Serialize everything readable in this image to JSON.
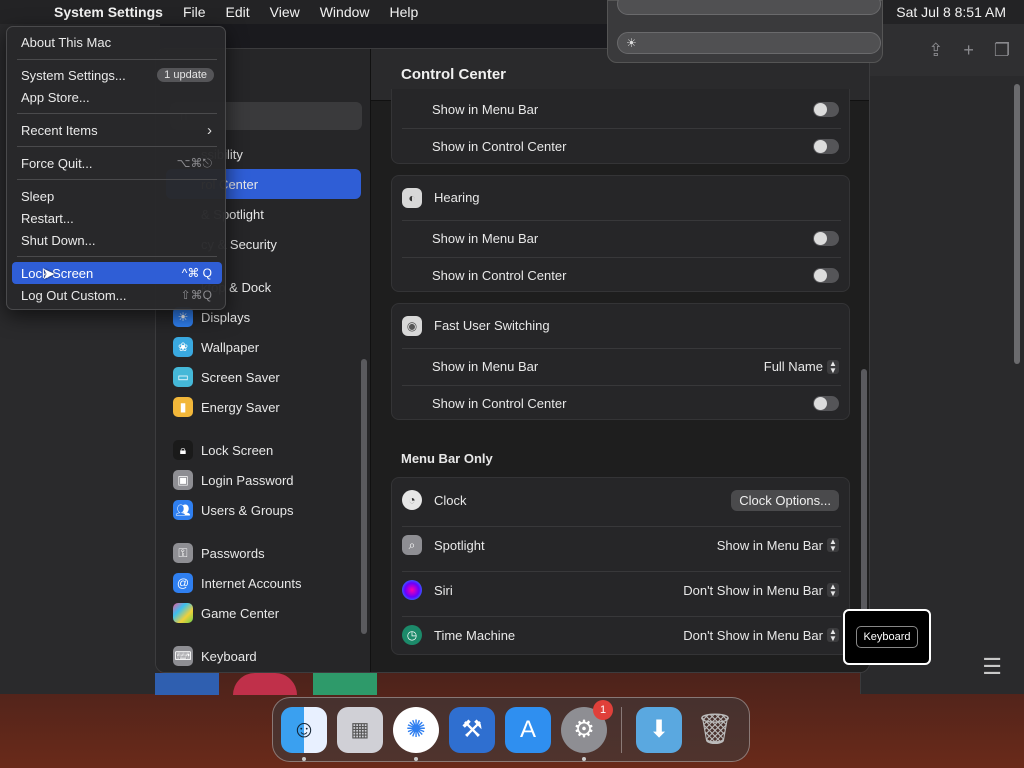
{
  "menubar": {
    "app_name": "System Settings",
    "items": [
      "File",
      "Edit",
      "View",
      "Window",
      "Help"
    ],
    "clock": "Sat Jul 8  8:51 AM"
  },
  "apple_menu": {
    "about": "About This Mac",
    "settings": "System Settings...",
    "settings_badge": "1 update",
    "app_store": "App Store...",
    "recent": "Recent Items",
    "recent_arrow": "›",
    "force_quit": "Force Quit...",
    "force_quit_sc": "⌥⌘⎋",
    "sleep": "Sleep",
    "restart": "Restart...",
    "shut_down": "Shut Down...",
    "lock": "Lock Screen",
    "lock_sc": "^⌘ Q",
    "logout": "Log Out Custom...",
    "logout_sc": "⇧⌘Q"
  },
  "sidebar": {
    "search_placeholder": "n",
    "items": [
      {
        "label": "ssibility"
      },
      {
        "label": "rol Center"
      },
      {
        "label": "& Spotlight"
      },
      {
        "label": "cy & Security"
      },
      {
        "label": "ktop & Dock"
      },
      {
        "label": "Displays"
      },
      {
        "label": "Wallpaper"
      },
      {
        "label": "Screen Saver"
      },
      {
        "label": "Energy Saver"
      },
      {
        "label": "Lock Screen"
      },
      {
        "label": "Login Password"
      },
      {
        "label": "Users & Groups"
      },
      {
        "label": "Passwords"
      },
      {
        "label": "Internet Accounts"
      },
      {
        "label": "Game Center"
      },
      {
        "label": "Keyboard"
      }
    ]
  },
  "content": {
    "title": "Control Center",
    "show_menu_bar": "Show in Menu Bar",
    "show_control_center": "Show in Control Center",
    "hearing": "Hearing",
    "fast_user": "Fast User Switching",
    "full_name": "Full Name",
    "menu_bar_only": "Menu Bar Only",
    "clock": "Clock",
    "clock_options": "Clock Options...",
    "spotlight": "Spotlight",
    "spotlight_value": "Show in Menu Bar",
    "siri": "Siri",
    "siri_value": "Don't Show in Menu Bar",
    "time_machine": "Time Machine",
    "time_machine_value": "Don't Show in Menu Bar"
  },
  "tooltip": {
    "keyboard": "Keyboard"
  },
  "dock": {
    "settings_badge": "1"
  },
  "colors": {
    "accent": "#2f5ed6",
    "badge": "#e0403a"
  }
}
